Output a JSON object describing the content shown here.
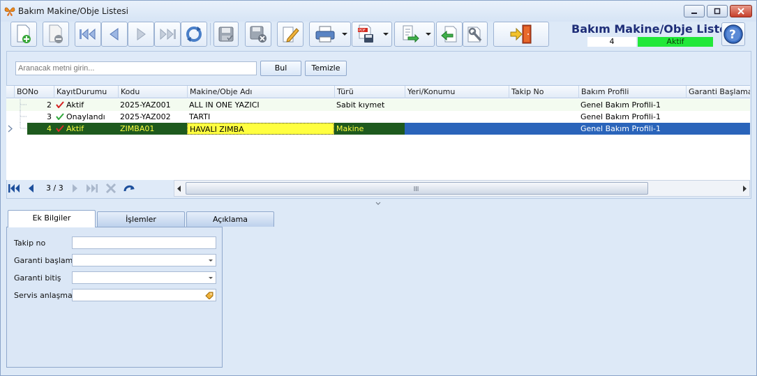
{
  "window": {
    "title": "Bakım Makine/Obje Listesi"
  },
  "header": {
    "title": "Bakım Makine/Obje Listesi",
    "record_count": "4",
    "status": "Aktif",
    "status_color": "#22e83a"
  },
  "toolbar": {
    "buttons": [
      "new-record",
      "delete-record",
      "first",
      "previous",
      "next",
      "last",
      "refresh",
      "save",
      "cancel",
      "edit",
      "print",
      "export-pdf",
      "import",
      "back",
      "settings",
      "exit"
    ],
    "help": "help"
  },
  "search": {
    "placeholder": "Aranacak metni girin...",
    "value": "",
    "find_label": "Bul",
    "clear_label": "Temizle"
  },
  "grid": {
    "columns": [
      "BONo",
      "KayıtDurumu",
      "Kodu",
      "Makine/Obje Adı",
      "Türü",
      "Yeri/Konumu",
      "Takip No",
      "Bakım Profili",
      "Garanti Başlama"
    ],
    "rows": [
      {
        "bono": "2",
        "durum": "Aktif",
        "kodu": "2025-YAZ001",
        "ad": "ALL IN ONE YAZICI",
        "turu": "Sabit kıymet",
        "yeri": "",
        "takip": "",
        "profil": "Genel Bakım Profili-1",
        "garanti": ""
      },
      {
        "bono": "3",
        "durum": "Onaylandı",
        "kodu": "2025-YAZ002",
        "ad": "TARTI",
        "turu": "",
        "yeri": "",
        "takip": "",
        "profil": "Genel Bakım Profili-1",
        "garanti": ""
      },
      {
        "bono": "4",
        "durum": "Aktif",
        "kodu": "ZIMBA01",
        "ad": "HAVALI ZIMBA",
        "turu": "Makine",
        "yeri": "",
        "takip": "",
        "profil": "Genel Bakım Profili-1",
        "garanti": ""
      }
    ],
    "selected_row": 2
  },
  "pager": {
    "position": "3 / 3"
  },
  "tabs": [
    "Ek Bilgiler",
    "İşlemler",
    "Açıklama"
  ],
  "form": {
    "takip_no_label": "Takip no",
    "takip_no_value": "",
    "garanti_baslama_label": "Garanti başlama",
    "garanti_baslama_value": "",
    "garanti_bitis_label": "Garanti bitiş",
    "garanti_bitis_value": "",
    "servis_label": "Servis anlaşması",
    "servis_value": ""
  }
}
